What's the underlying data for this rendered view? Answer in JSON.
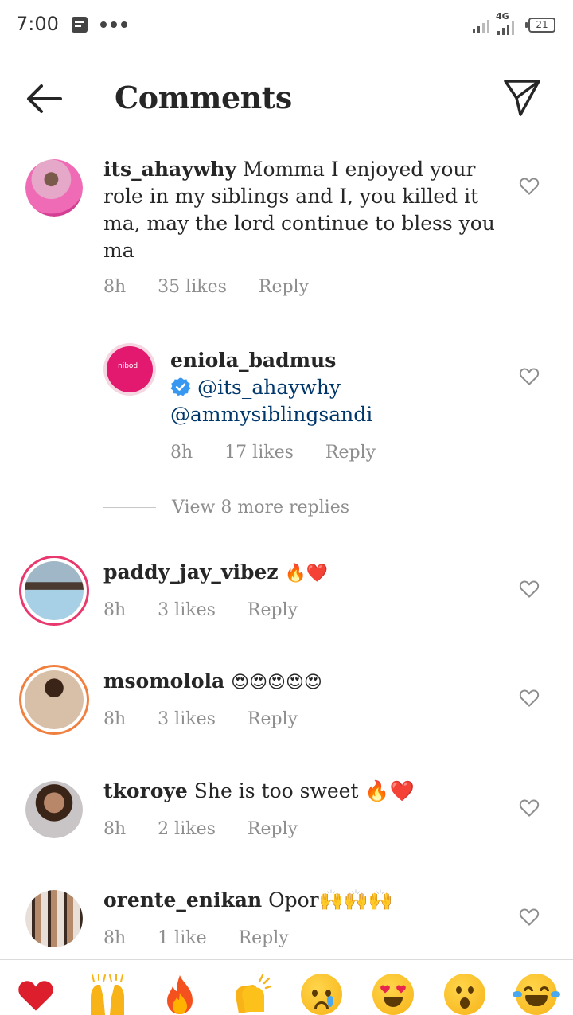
{
  "status_bar": {
    "time": "7:00",
    "network": "4G",
    "battery": "21"
  },
  "header": {
    "title": "Comments",
    "back_icon": "arrow-left-icon",
    "send_icon": "paper-plane-icon"
  },
  "comments": [
    {
      "username": "its_ahaywhy",
      "text": "Momma I enjoyed your role in my siblings and I, you killed it ma, may the lord continue to bless you ma",
      "time": "8h",
      "likes": "35 likes",
      "reply": "Reply"
    },
    {
      "username": "eniola_badmus",
      "mention1": "@its_ahaywhy",
      "mention2": "@ammysiblingsandi",
      "time": "8h",
      "likes": "17 likes",
      "reply": "Reply",
      "avatar_label": "nibod"
    },
    {
      "username": "paddy_jay_vibez",
      "text": "🔥❤️",
      "time": "8h",
      "likes": "3 likes",
      "reply": "Reply"
    },
    {
      "username": "msomololа",
      "text": "😍😍😍😍😍",
      "time": "8h",
      "likes": "3 likes",
      "reply": "Reply"
    },
    {
      "username": "tkoroye",
      "text": "She is too sweet 🔥❤️",
      "time": "8h",
      "likes": "2 likes",
      "reply": "Reply"
    },
    {
      "username": "orente_enikan",
      "text": "Opor🙌🙌🙌",
      "time": "8h",
      "likes": "1 like",
      "reply": "Reply"
    }
  ],
  "view_more_replies": "View 8 more replies",
  "emoji_bar": [
    "red-heart",
    "raising-hands",
    "fire",
    "clapping-hands",
    "crying-face",
    "heart-eyes-face",
    "surprised-face",
    "tears-of-joy-face"
  ],
  "colors": {
    "text": "#262626",
    "secondary": "#8e8e8e",
    "mention": "#00376b",
    "verified": "#3897f0",
    "heart": "#ed4956"
  }
}
